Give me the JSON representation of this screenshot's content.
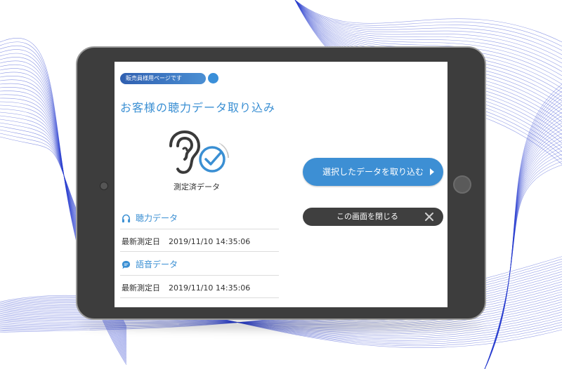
{
  "badge": {
    "label": "販売員様用ページです"
  },
  "page": {
    "title": "お客様の聴力データ取り込み"
  },
  "status": {
    "label": "測定済データ",
    "icons": [
      "ear-icon",
      "checkmark-circle-icon"
    ]
  },
  "hearing": {
    "title": "聴力データ",
    "icon": "headphones-icon",
    "date_label": "最新測定日",
    "date_value": "2019/11/10 14:35:06"
  },
  "speech": {
    "title": "語音データ",
    "icon": "speech-bubble-icon",
    "date_label": "最新測定日",
    "date_value": "2019/11/10 14:35:06"
  },
  "actions": {
    "import_label": "選択したデータを取り込む",
    "close_label": "この画面を閉じる"
  },
  "colors": {
    "accent": "#3d8fd4",
    "dark_button": "#3f3f3f",
    "tablet_frame": "#3d3d3d",
    "wave": "#2b3fd0"
  }
}
